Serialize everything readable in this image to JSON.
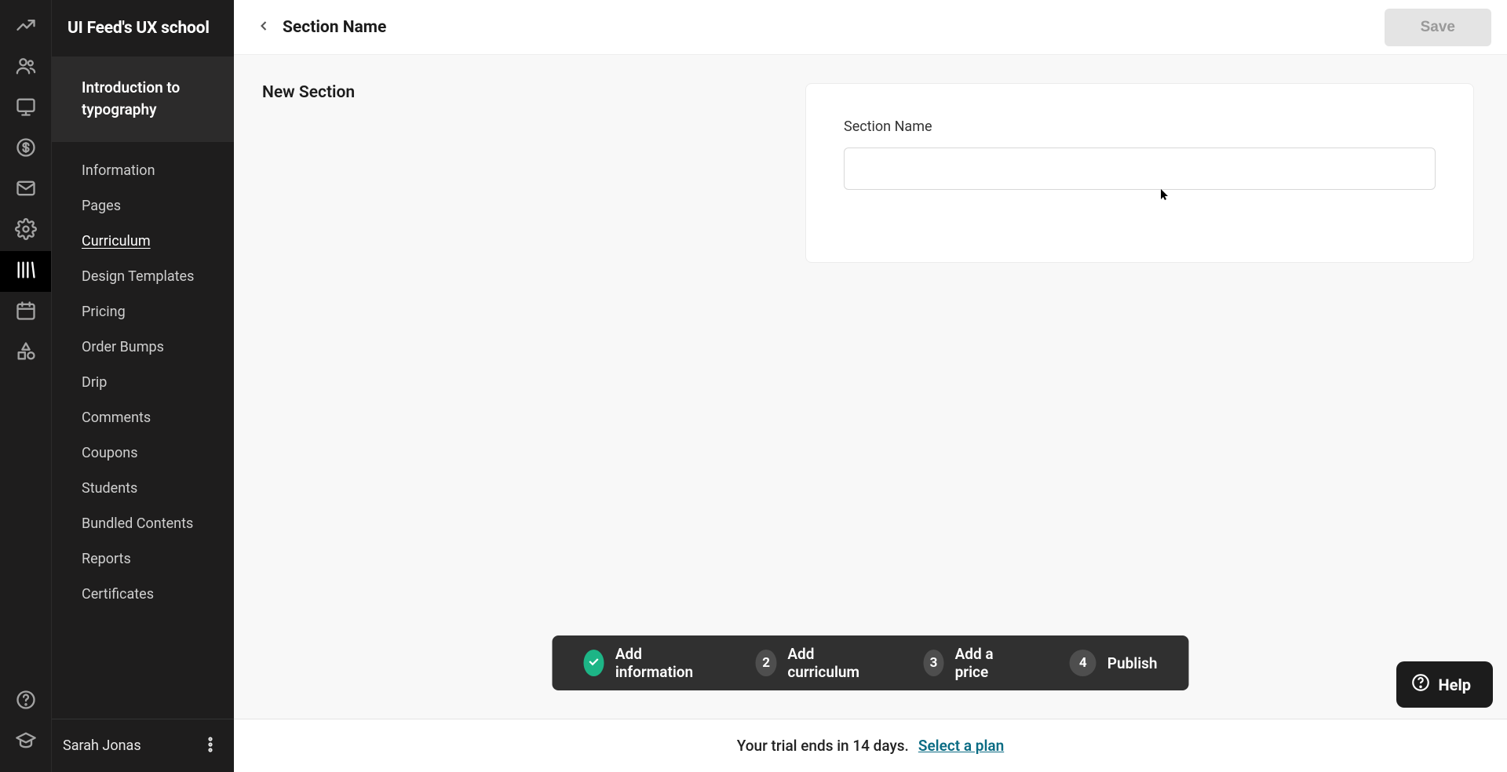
{
  "school_name": "UI Feed's UX school",
  "course_title": "Introduction to typography",
  "sidebar_nav": {
    "information": "Information",
    "pages": "Pages",
    "curriculum": "Curriculum",
    "design_templates": "Design Templates",
    "pricing": "Pricing",
    "order_bumps": "Order Bumps",
    "drip": "Drip",
    "comments": "Comments",
    "coupons": "Coupons",
    "students": "Students",
    "bundled_contents": "Bundled Contents",
    "reports": "Reports",
    "certificates": "Certificates"
  },
  "user_name": "Sarah Jonas",
  "topbar": {
    "title": "Section Name",
    "save": "Save"
  },
  "panel": {
    "heading": "New Section",
    "field_label": "Section Name",
    "field_value": ""
  },
  "steps": {
    "s1": "Add information",
    "s2": "Add curriculum",
    "s3": "Add a price",
    "s4": "Publish",
    "n2": "2",
    "n3": "3",
    "n4": "4"
  },
  "trial": {
    "msg": "Your trial ends in 14 days.",
    "link": "Select a plan"
  },
  "help_label": "Help"
}
